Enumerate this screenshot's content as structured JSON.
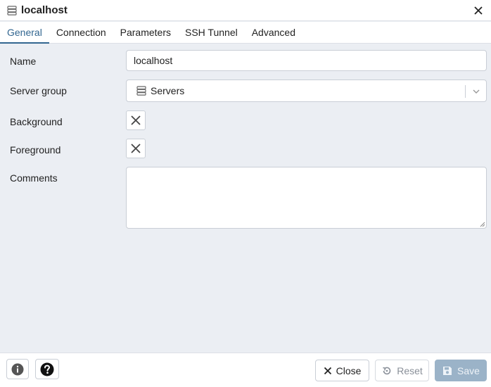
{
  "dialog": {
    "title": "localhost",
    "title_icon": "server-icon",
    "close_icon": "close-icon"
  },
  "tabs": [
    {
      "label": "General",
      "active": true
    },
    {
      "label": "Connection",
      "active": false
    },
    {
      "label": "Parameters",
      "active": false
    },
    {
      "label": "SSH Tunnel",
      "active": false
    },
    {
      "label": "Advanced",
      "active": false
    }
  ],
  "form": {
    "name": {
      "label": "Name",
      "value": "localhost"
    },
    "server_group": {
      "label": "Server group",
      "value": "Servers",
      "icon": "server-group-icon"
    },
    "background": {
      "label": "Background",
      "icon": "clear-color-icon"
    },
    "foreground": {
      "label": "Foreground",
      "icon": "clear-color-icon"
    },
    "comments": {
      "label": "Comments",
      "value": ""
    }
  },
  "footer": {
    "info_icon": "info-icon",
    "help_icon": "help-icon",
    "close_label": "Close",
    "reset_label": "Reset",
    "save_label": "Save"
  },
  "colors": {
    "accent": "#326690",
    "background": "#ebeef3",
    "save_disabled": "#9bb3c8"
  }
}
